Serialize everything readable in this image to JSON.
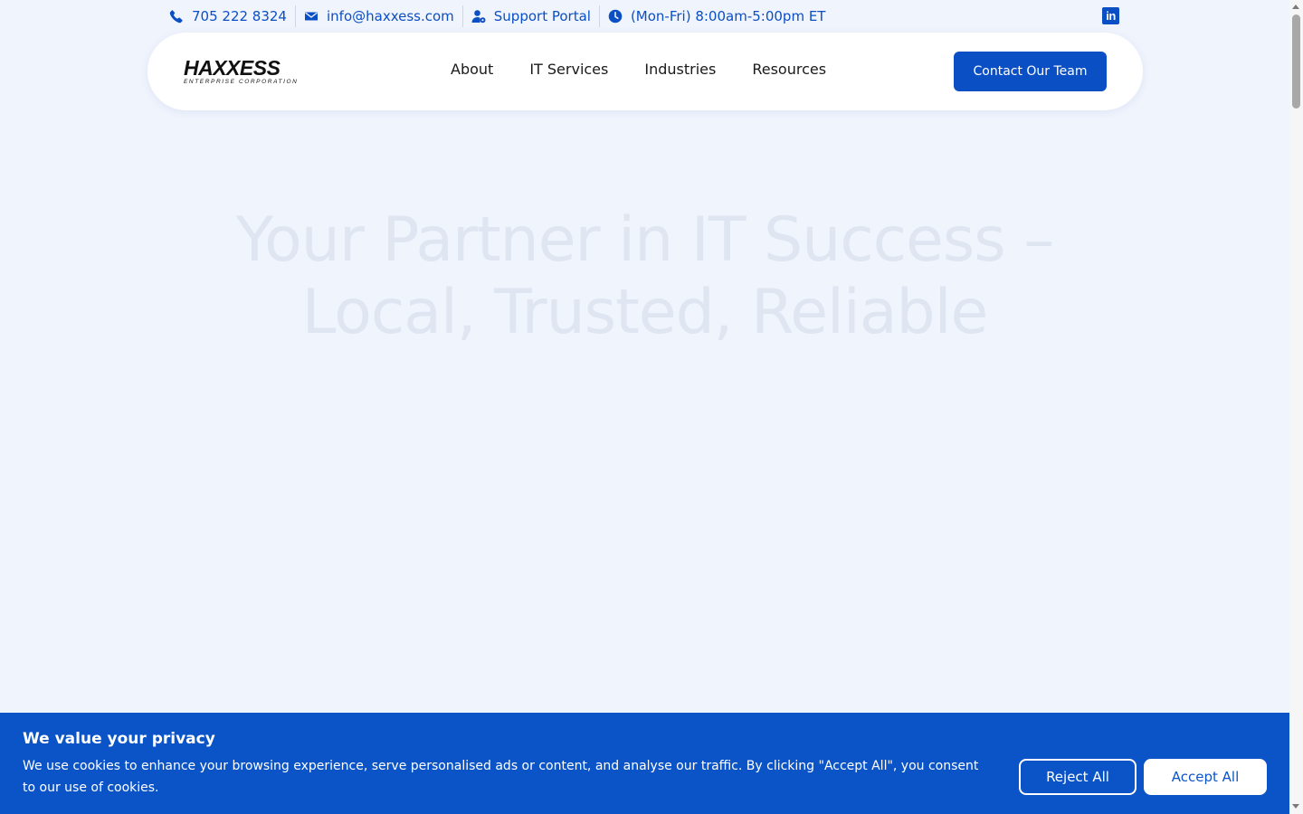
{
  "topbar": {
    "phone": "705 222 8324",
    "email": "info@haxxess.com",
    "support": "Support Portal",
    "hours": "(Mon-Fri) 8:00am-5:00pm ET",
    "icons": [
      "phone-icon",
      "envelope-icon",
      "user-support-icon",
      "clock-icon",
      "linkedin-icon"
    ]
  },
  "logo": {
    "wordmark": "HAXXESS",
    "subtitle": "ENTERPRISE CORPORATION"
  },
  "nav": {
    "items": [
      "About",
      "IT Services",
      "Industries",
      "Resources"
    ],
    "cta": "Contact Our Team"
  },
  "hero": {
    "title_line1": "Your Partner in IT Success –",
    "title_line2": "Local, Trusted, Reliable"
  },
  "cookie": {
    "title": "We value your privacy",
    "text": "We use cookies to enhance your browsing experience, serve personalised ads or content, and analyse our traffic. By clicking \"Accept All\", you consent to our use of cookies.",
    "reject": "Reject All",
    "accept": "Accept All"
  },
  "colors": {
    "brand": "#0b4fc4",
    "banner": "#0b54c8",
    "background": "#f0f4fd"
  }
}
